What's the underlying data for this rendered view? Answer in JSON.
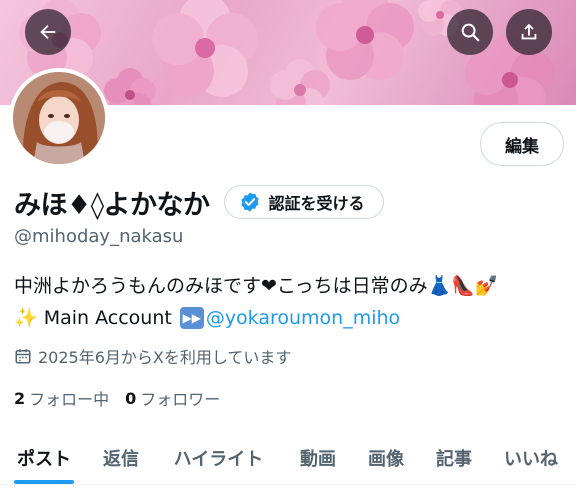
{
  "header": {
    "back_icon": "arrow-left-icon",
    "search_icon": "search-icon",
    "share_icon": "share-icon"
  },
  "profile": {
    "display_name": "みほ♦︎◊よかなか",
    "verify_label": "認証を受ける",
    "handle": "@mihoday_nakasu",
    "edit_label": "編集",
    "bio_line1": "中洲よかろうもんのみほです❤︎こっちは日常のみ👗👠💅",
    "bio_line2_prefix": "✨ Main Account",
    "bio_link": "@yokaroumon_miho",
    "joined": "2025年6月からXを利用しています",
    "following_count": "2",
    "following_label": "フォロー中",
    "followers_count": "0",
    "followers_label": "フォロワー"
  },
  "tabs": [
    {
      "label": "ポスト",
      "active": true
    },
    {
      "label": "返信",
      "active": false
    },
    {
      "label": "ハイライト",
      "active": false
    },
    {
      "label": "動画",
      "active": false
    },
    {
      "label": "画像",
      "active": false
    },
    {
      "label": "記事",
      "active": false
    },
    {
      "label": "いいね",
      "active": false
    }
  ],
  "colors": {
    "accent": "#1d9bf0",
    "text": "#0f1419",
    "secondary": "#536471",
    "banner": "#e9a6c9"
  }
}
